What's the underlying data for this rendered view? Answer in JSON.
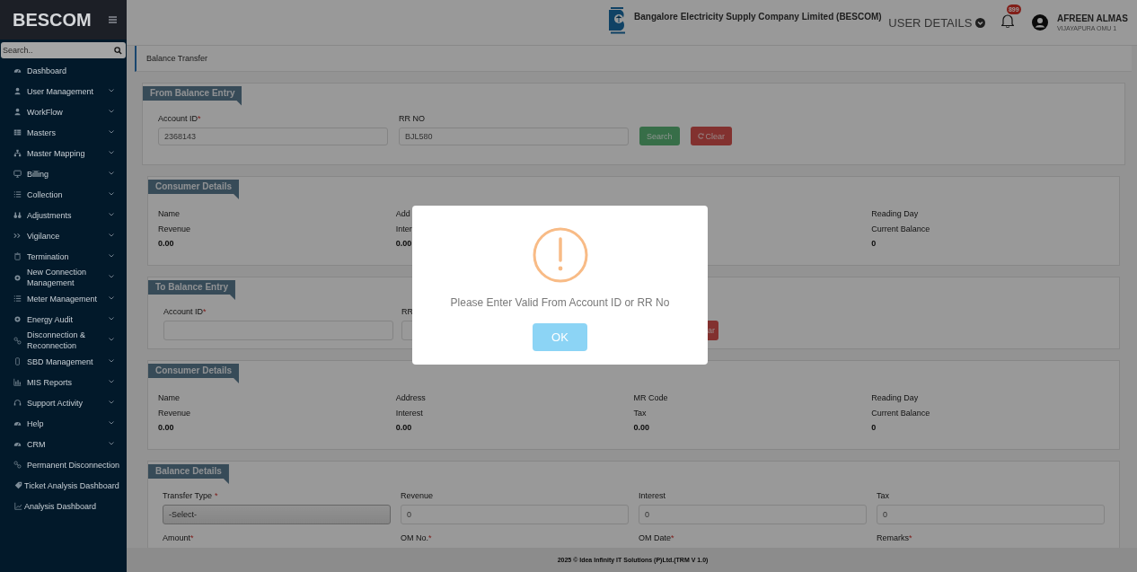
{
  "sidebar": {
    "brand": "BESCOM",
    "search": {
      "placeholder": "Search.."
    },
    "items": [
      {
        "label": "Dashboard",
        "expandable": false
      },
      {
        "label": "User Management",
        "expandable": true
      },
      {
        "label": "WorkFlow",
        "expandable": true
      },
      {
        "label": "Masters",
        "expandable": true
      },
      {
        "label": "Master Mapping",
        "expandable": true
      },
      {
        "label": "Billing",
        "expandable": true
      },
      {
        "label": "Collection",
        "expandable": true
      },
      {
        "label": "Adjustments",
        "expandable": true
      },
      {
        "label": "Vigilance",
        "expandable": true
      },
      {
        "label": "Termination",
        "expandable": true
      },
      {
        "label": "New Connection Management",
        "expandable": true
      },
      {
        "label": "Meter Management",
        "expandable": true
      },
      {
        "label": "Energy Audit",
        "expandable": true
      },
      {
        "label": "Disconnection & Reconnection",
        "expandable": true
      },
      {
        "label": "SBD Management",
        "expandable": true
      },
      {
        "label": "MIS Reports",
        "expandable": true
      },
      {
        "label": "Support Activity",
        "expandable": true
      },
      {
        "label": "Help",
        "expandable": true
      },
      {
        "label": "CRM",
        "expandable": true
      },
      {
        "label": "Permanent Disconnection",
        "expandable": false
      },
      {
        "label": "Ticket Analysis Dashboard",
        "expandable": false
      },
      {
        "label": "Analysis Dashboard",
        "expandable": false
      }
    ]
  },
  "header": {
    "company": "Bangalore Electricity Supply Company Limited (BESCOM)",
    "user_details": "USER DETAILS",
    "notification_count": "899",
    "user_name": "AFREEN ALMAS",
    "user_location": "VIJAYAPURA OMU 1"
  },
  "page_title": "Balance Transfer",
  "from_entry": {
    "title": "From Balance Entry",
    "fields": [
      {
        "label": "Account ID",
        "mark": "*",
        "value": "2368143"
      },
      {
        "label": "RR NO",
        "value": "BJL580"
      }
    ],
    "search_button": "Search",
    "clear_button": "Clear"
  },
  "consumer_details_from": {
    "title": "Consumer Details",
    "columns": [
      {
        "covered": false,
        "label_1": "Name",
        "label_2": "Revenue",
        "value": "0.00"
      },
      {
        "covered": false,
        "label_1": "Add",
        "label_2": "Inter",
        "value": "0.00"
      },
      {
        "covered": true
      },
      {
        "covered": false,
        "label_1": "Reading Day",
        "label_2": "Current Balance",
        "value": "0"
      }
    ]
  },
  "to_entry": {
    "title": "To Balance Entry",
    "fields": [
      {
        "label": "Account ID",
        "mark": "*"
      },
      {
        "label": "RR"
      }
    ],
    "clear_button": "ar"
  },
  "consumer_details_to": {
    "title": "Consumer Details",
    "columns": [
      {
        "covered": false,
        "label_1": "Name",
        "label_2": "Revenue",
        "value": "0.00"
      },
      {
        "covered": false,
        "label_1": "Address",
        "label_2": "Interest",
        "value": "0.00"
      },
      {
        "covered": false,
        "label_1": "MR Code",
        "label_2": "Tax",
        "value": "0.00"
      },
      {
        "covered": false,
        "label_1": "Reading Day",
        "label_2": "Current Balance",
        "value": "0"
      }
    ]
  },
  "balance_details": {
    "title": "Balance Details",
    "fields": [
      {
        "kind": "select",
        "label": "Transfer Type",
        "mark": "*",
        "value": "-Select-"
      },
      {
        "kind": "input",
        "label": "Revenue",
        "value": "0"
      },
      {
        "kind": "input",
        "label": "Interest",
        "value": "0"
      },
      {
        "kind": "input",
        "label": "Tax",
        "value": "0"
      },
      {
        "kind": "label",
        "label": "Amount",
        "mark": "*"
      },
      {
        "kind": "label",
        "label": "OM No.",
        "mark": "*"
      },
      {
        "kind": "label",
        "label": "OM Date",
        "mark": "*"
      },
      {
        "kind": "label",
        "label": "Remarks",
        "mark": "*"
      }
    ]
  },
  "footer": "2025 © Idea Infinity IT Solutions (P)Ltd.(TRM V 1.0)",
  "dialog": {
    "message": "Please Enter Valid From Account ID or RR No",
    "button": "OK"
  }
}
